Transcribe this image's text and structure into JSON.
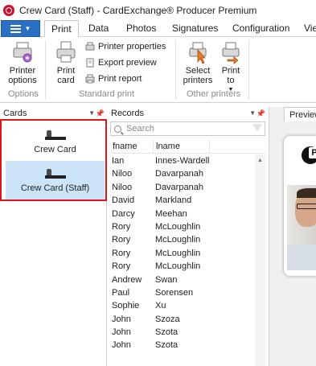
{
  "window": {
    "title": "Crew Card (Staff) - CardExchange® Producer Premium"
  },
  "ribbon_tabs": [
    "Print",
    "Data",
    "Photos",
    "Signatures",
    "Configuration",
    "Vie"
  ],
  "ribbon": {
    "printer_options": "Printer options",
    "print_card": "Print card",
    "printer_properties": "Printer properties",
    "export_preview": "Export preview",
    "print_report": "Print report",
    "select_printers": "Select printers",
    "print_to": "Print to",
    "groups": {
      "options": "Options",
      "standard_print": "Standard print",
      "other_printers": "Other printers"
    }
  },
  "cards_panel": {
    "title": "Cards",
    "items": [
      {
        "label": "Crew Card",
        "selected": false
      },
      {
        "label": "Crew Card (Staff)",
        "selected": true
      }
    ]
  },
  "records_panel": {
    "title": "Records",
    "search_placeholder": "Search",
    "columns": [
      "fname",
      "lname"
    ],
    "rows": [
      [
        "Ian",
        "Innes-Wardell"
      ],
      [
        "Niloo",
        "Davarpanah"
      ],
      [
        "Niloo",
        "Davarpanah"
      ],
      [
        "David",
        "Markland"
      ],
      [
        "Darcy",
        "Meehan"
      ],
      [
        "Rory",
        "McLoughlin"
      ],
      [
        "Rory",
        "McLoughlin"
      ],
      [
        "Rory",
        "McLoughlin"
      ],
      [
        "Rory",
        "McLoughlin"
      ],
      [
        "Andrew",
        "Swan"
      ],
      [
        "Paul",
        "Sorensen"
      ],
      [
        "Sophie",
        "Xu"
      ],
      [
        "John",
        "Szoza"
      ],
      [
        "John",
        "Szota"
      ],
      [
        "John",
        "Szota"
      ]
    ]
  },
  "preview_panel": {
    "title": "Preview",
    "logo_letter": "P"
  },
  "colors": {
    "accent": "#2b6fc4",
    "selection": "#cce4f7",
    "highlight_border": "#d9161c"
  }
}
